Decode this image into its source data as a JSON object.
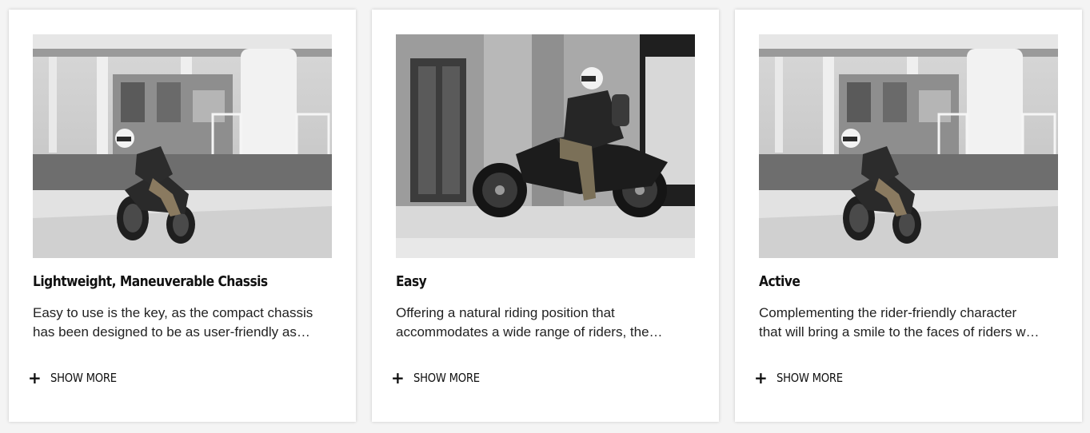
{
  "cards": [
    {
      "title": "Lightweight, Maneuverable Chassis",
      "desc_line1": "Easy to use is the key, as the compact chassis",
      "desc_line2": "has been designed to be as user-friendly as…",
      "show_more_label": "SHOW MORE",
      "plus_icon": "+",
      "photo": "motorcycle-rider-cornering-station-photo"
    },
    {
      "title": "Easy",
      "desc_line1": "Offering a natural riding position that",
      "desc_line2": "accommodates a wide range of riders, the…",
      "show_more_label": "SHOW MORE",
      "plus_icon": "+",
      "photo": "motorcycle-rider-side-view-photo"
    },
    {
      "title": "Active",
      "desc_line1": "Complementing the rider-friendly character",
      "desc_line2": "that will bring a smile to the faces of riders w…",
      "show_more_label": "SHOW MORE",
      "plus_icon": "+",
      "photo": "motorcycle-rider-cornering-station-photo"
    }
  ],
  "colors": {
    "page_background": "#f4f4f4",
    "card_background": "#ffffff",
    "text": "#111111"
  }
}
